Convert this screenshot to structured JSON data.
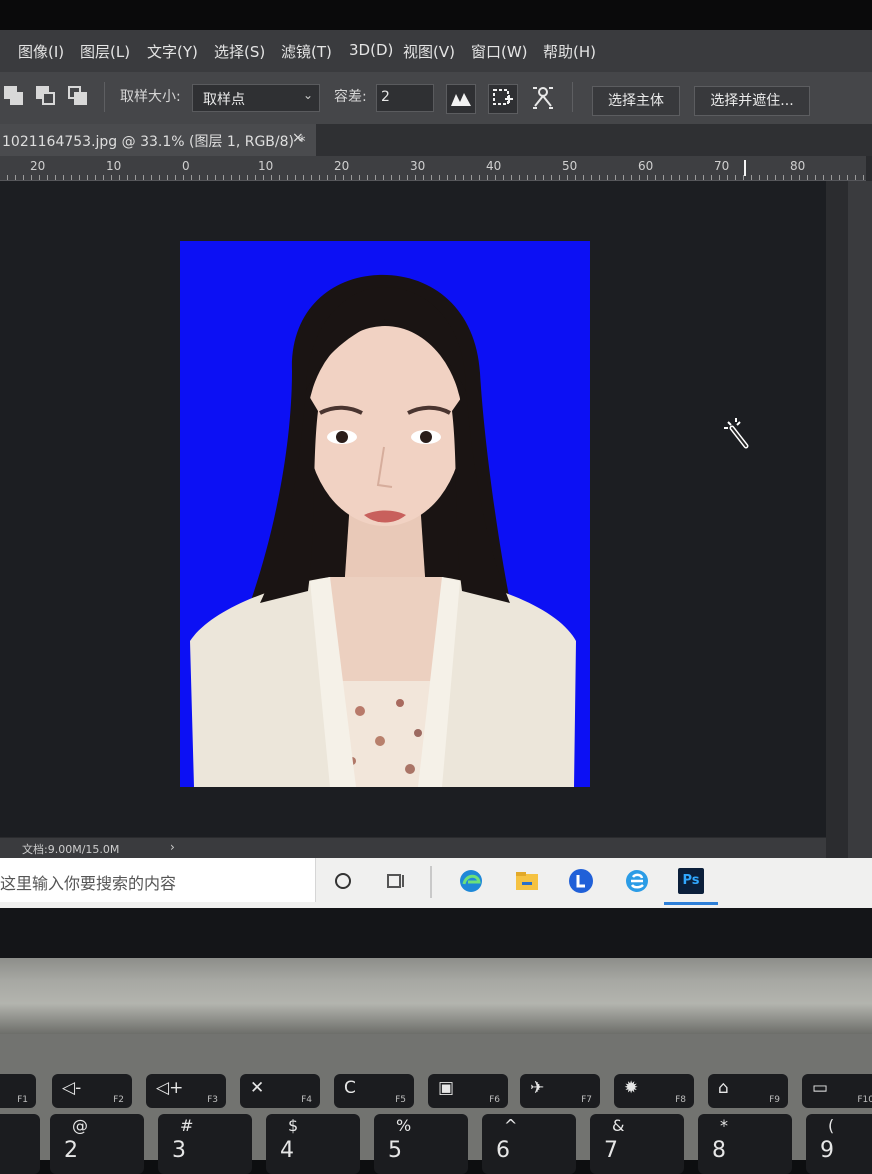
{
  "menubar": {
    "items": [
      "图像(I)",
      "图层(L)",
      "文字(Y)",
      "选择(S)",
      "滤镜(T)",
      "3D(D)",
      "视图(V)",
      "窗口(W)",
      "帮助(H)"
    ]
  },
  "options": {
    "sample_size_label": "取样大小:",
    "sample_size_value": "取样点",
    "tolerance_label": "容差:",
    "tolerance_value": "2",
    "select_subject_label": "选择主体",
    "select_and_mask_label": "选择并遮住..."
  },
  "document_tab": {
    "title": "1021164753.jpg @ 33.1% (图层 1, RGB/8) *",
    "close": "×"
  },
  "ruler": {
    "labels": [
      "20",
      "10",
      "0",
      "10",
      "20",
      "30",
      "40",
      "50",
      "60",
      "70",
      "80"
    ]
  },
  "status_bar": {
    "doc_size": "文档:9.00M/15.0M",
    "arrow": "›"
  },
  "taskbar": {
    "search_placeholder": "这里输入你要搜索的内容",
    "ps_label": "Ps"
  },
  "keyboard": {
    "fn_keys": [
      {
        "label": "F1",
        "icon": ""
      },
      {
        "label": "F2",
        "icon": "◁-"
      },
      {
        "label": "F3",
        "icon": "◁+"
      },
      {
        "label": "F4",
        "icon": "✕"
      },
      {
        "label": "F5",
        "icon": "C"
      },
      {
        "label": "F6",
        "icon": "▣"
      },
      {
        "label": "F7",
        "icon": "✈"
      },
      {
        "label": "F8",
        "icon": "✹"
      },
      {
        "label": "F9",
        "icon": "⌂"
      },
      {
        "label": "F10",
        "icon": "▭"
      }
    ],
    "num_keys": [
      {
        "top": "@",
        "bottom": "2"
      },
      {
        "top": "#",
        "bottom": "3"
      },
      {
        "top": "$",
        "bottom": "4"
      },
      {
        "top": "%",
        "bottom": "5"
      },
      {
        "top": "^",
        "bottom": "6"
      },
      {
        "top": "&",
        "bottom": "7"
      },
      {
        "top": "*",
        "bottom": "8"
      },
      {
        "top": "(",
        "bottom": "9"
      }
    ]
  },
  "colors": {
    "photo_background": "#0c10f4",
    "workspace": "#1c1e22",
    "menubar": "#3a3b3e"
  }
}
